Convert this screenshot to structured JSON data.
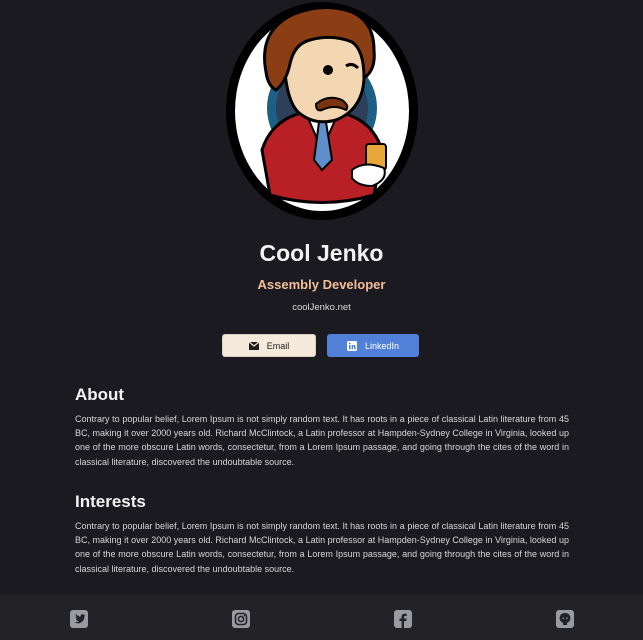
{
  "profile": {
    "name": "Cool Jenko",
    "role": "Assembly Developer",
    "website": "coolJenko.net"
  },
  "buttons": {
    "email_label": "Email",
    "linkedin_label": "LinkedIn"
  },
  "sections": {
    "about": {
      "title": "About",
      "body": "Contrary to popular belief, Lorem Ipsum is not simply random text. It has roots in a piece of classical Latin literature from 45 BC, making it over 2000 years old. Richard McClintock, a Latin professor at Hampden-Sydney College in Virginia, looked up one of the more obscure Latin words, consectetur, from a Lorem Ipsum passage, and going through the cites of the word in classical literature, discovered the undoubtable source."
    },
    "interests": {
      "title": "Interests",
      "body": "Contrary to popular belief, Lorem Ipsum is not simply random text. It has roots in a piece of classical Latin literature from 45 BC, making it over 2000 years old. Richard McClintock, a Latin professor at Hampden-Sydney College in Virginia, looked up one of the more obscure Latin words, consectetur, from a Lorem Ipsum passage, and going through the cites of the word in classical literature, discovered the undoubtable source."
    }
  },
  "footer": {
    "icons": [
      "twitter-icon",
      "instagram-icon",
      "facebook-icon",
      "github-icon"
    ]
  },
  "colors": {
    "background": "#1a1a20",
    "accent_role": "#f3bf99",
    "email_button": "#f5eadb",
    "linkedin_button": "#5080d8",
    "footer": "#222227"
  }
}
